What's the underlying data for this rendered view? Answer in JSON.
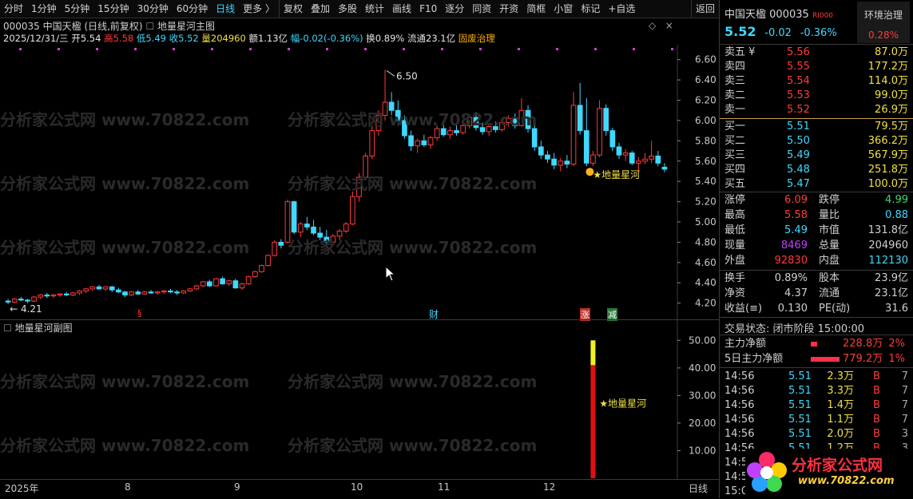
{
  "toolbar": {
    "items": [
      "分时",
      "1分钟",
      "5分钟",
      "15分钟",
      "30分钟",
      "60分钟",
      "日线",
      "更多 〉",
      "复权",
      "叠加",
      "多股",
      "统计",
      "画线",
      "F10",
      "逐分",
      "同资",
      "开资",
      "简框",
      "小窗",
      "标记",
      "+自选",
      "返回"
    ],
    "active": "日线"
  },
  "chart": {
    "code_name": "000035 中国天楹 (日线,前复权)",
    "indicator_name": "地量星河主图",
    "date": "2025/12/31/三",
    "open": "开5.54",
    "high": "高5.58",
    "low": "低5.49",
    "close": "收5.52",
    "volume": "量204960",
    "amount": "额1.13亿",
    "change": "幅-0.02(-0.36%)",
    "turnover": "换0.89%",
    "float": "流通23.1亿",
    "concept": "固废治理",
    "price_ticks": [
      "6.60",
      "6.40",
      "6.20",
      "6.00",
      "5.80",
      "5.60",
      "5.40",
      "5.20",
      "5.00",
      "4.80",
      "4.60",
      "4.40",
      "4.20"
    ],
    "max_label": "6.50",
    "min_label": "4.21",
    "signal_label": "★地量星河",
    "markers": {
      "s": "§",
      "cai": "财",
      "zhang": "涨",
      "jian": "减"
    }
  },
  "sub": {
    "name": "地量星河副图",
    "ticks": [
      "50.00",
      "40.00",
      "30.00",
      "20.00",
      "10.00"
    ],
    "signal_label": "★地量星河",
    "bar_value": 50,
    "bar_yellow_value": 41
  },
  "x_axis": {
    "labels": [
      "2025年",
      "8",
      "9",
      "10",
      "11",
      "12"
    ],
    "period": "日线"
  },
  "quote": {
    "name": "中国天楹",
    "code": "000035",
    "tag": "RI000",
    "sector": "环境治理",
    "sector_change": "0.28%",
    "price": "5.52",
    "change": "-0.02",
    "pct": "-0.36%",
    "sell": [
      {
        "l": "卖五 ¥",
        "p": "5.56",
        "v": "87.0万"
      },
      {
        "l": "卖四",
        "p": "5.55",
        "v": "177.2万"
      },
      {
        "l": "卖三",
        "p": "5.54",
        "v": "114.0万"
      },
      {
        "l": "卖二",
        "p": "5.53",
        "v": "99.0万"
      },
      {
        "l": "卖一",
        "p": "5.52",
        "v": "26.9万"
      }
    ],
    "buy": [
      {
        "l": "买一",
        "p": "5.51",
        "v": "79.5万"
      },
      {
        "l": "买二",
        "p": "5.50",
        "v": "366.2万"
      },
      {
        "l": "买三",
        "p": "5.49",
        "v": "567.9万"
      },
      {
        "l": "买四",
        "p": "5.48",
        "v": "251.8万"
      },
      {
        "l": "买五",
        "p": "5.47",
        "v": "100.0万"
      }
    ],
    "stats": [
      {
        "l1": "涨停",
        "v1": "6.09",
        "l2": "跌停",
        "v2": "4.99"
      },
      {
        "l1": "最高",
        "v1": "5.58",
        "l2": "量比",
        "v2": "0.88"
      },
      {
        "l1": "最低",
        "v1": "5.49",
        "l2": "市值",
        "v2": "131.8亿"
      },
      {
        "l1": "现量",
        "v1": "8469",
        "l2": "总量",
        "v2": "204960"
      },
      {
        "l1": "外盘",
        "v1": "92830",
        "l2": "内盘",
        "v2": "112130"
      }
    ],
    "stats2": [
      {
        "l1": "换手",
        "v1": "0.89%",
        "l2": "股本",
        "v2": "23.9亿"
      },
      {
        "l1": "净资",
        "v1": "4.37",
        "l2": "流通",
        "v2": "23.1亿"
      },
      {
        "l1": "收益(≡)",
        "v1": "0.130",
        "l2": "PE(动)",
        "v2": "31.6"
      }
    ],
    "status": "交易状态: 闭市阶段 15:00:00",
    "flow": [
      {
        "l": "主力净额",
        "v": "228.8万",
        "p": "2%"
      },
      {
        "l": "5日主力净额",
        "v": "779.2万",
        "p": "1%"
      }
    ],
    "ticks": [
      {
        "t": "14:56",
        "p": "5.51",
        "v": "2.3万",
        "s": "B",
        "n": "7"
      },
      {
        "t": "14:56",
        "p": "5.51",
        "v": "3.3万",
        "s": "B",
        "n": "7"
      },
      {
        "t": "14:56",
        "p": "5.51",
        "v": "1.4万",
        "s": "B",
        "n": "7"
      },
      {
        "t": "14:56",
        "p": "5.51",
        "v": "1.1万",
        "s": "B",
        "n": "7"
      },
      {
        "t": "14:56",
        "p": "5.51",
        "v": "2.0万",
        "s": "B",
        "n": "3"
      },
      {
        "t": "14:56",
        "p": "5.51",
        "v": "1.2万",
        "s": "B",
        "n": "3"
      },
      {
        "t": "14:5",
        "p": "",
        "v": "",
        "s": "",
        "n": ""
      },
      {
        "t": "14:5",
        "p": "",
        "v": "",
        "s": "",
        "n": ""
      },
      {
        "t": "15:0",
        "p": "",
        "v": "",
        "s": "",
        "n": ""
      }
    ],
    "logo": "分析家公式网",
    "logo_url": "www.70822.com"
  },
  "watermark": "分析家公式网 www.70822.com",
  "chart_data": {
    "type": "candlestick",
    "series": [
      {
        "name": "K线",
        "ohlc": [
          [
            4.22,
            4.24,
            4.19,
            4.21
          ],
          [
            4.21,
            4.25,
            4.2,
            4.24
          ],
          [
            4.24,
            4.26,
            4.22,
            4.23
          ],
          [
            4.23,
            4.24,
            4.2,
            4.22
          ],
          [
            4.22,
            4.27,
            4.21,
            4.26
          ],
          [
            4.26,
            4.29,
            4.24,
            4.28
          ],
          [
            4.28,
            4.3,
            4.25,
            4.27
          ],
          [
            4.27,
            4.29,
            4.25,
            4.28
          ],
          [
            4.28,
            4.3,
            4.26,
            4.29
          ],
          [
            4.29,
            4.31,
            4.27,
            4.28
          ],
          [
            4.28,
            4.31,
            4.27,
            4.3
          ],
          [
            4.3,
            4.33,
            4.28,
            4.32
          ],
          [
            4.32,
            4.35,
            4.3,
            4.34
          ],
          [
            4.34,
            4.37,
            4.32,
            4.36
          ],
          [
            4.36,
            4.38,
            4.33,
            4.34
          ],
          [
            4.34,
            4.37,
            4.32,
            4.36
          ],
          [
            4.36,
            4.37,
            4.31,
            4.33
          ],
          [
            4.33,
            4.35,
            4.3,
            4.31
          ],
          [
            4.31,
            4.32,
            4.26,
            4.28
          ],
          [
            4.28,
            4.32,
            4.27,
            4.31
          ],
          [
            4.31,
            4.33,
            4.28,
            4.29
          ],
          [
            4.29,
            4.32,
            4.28,
            4.31
          ],
          [
            4.31,
            4.33,
            4.29,
            4.3
          ],
          [
            4.3,
            4.32,
            4.28,
            4.31
          ],
          [
            4.31,
            4.33,
            4.29,
            4.32
          ],
          [
            4.32,
            4.34,
            4.3,
            4.31
          ],
          [
            4.31,
            4.33,
            4.28,
            4.3
          ],
          [
            4.3,
            4.33,
            4.29,
            4.32
          ],
          [
            4.32,
            4.35,
            4.31,
            4.34
          ],
          [
            4.34,
            4.38,
            4.33,
            4.37
          ],
          [
            4.37,
            4.42,
            4.36,
            4.41
          ],
          [
            4.41,
            4.43,
            4.36,
            4.37
          ],
          [
            4.37,
            4.45,
            4.36,
            4.44
          ],
          [
            4.44,
            4.46,
            4.38,
            4.39
          ],
          [
            4.39,
            4.43,
            4.37,
            4.42
          ],
          [
            4.42,
            4.44,
            4.34,
            4.35
          ],
          [
            4.35,
            4.4,
            4.33,
            4.39
          ],
          [
            4.39,
            4.47,
            4.38,
            4.46
          ],
          [
            4.46,
            4.52,
            4.45,
            4.51
          ],
          [
            4.51,
            4.58,
            4.5,
            4.57
          ],
          [
            4.57,
            4.68,
            4.56,
            4.67
          ],
          [
            4.67,
            4.82,
            4.66,
            4.8
          ],
          [
            4.8,
            4.83,
            4.74,
            4.77
          ],
          [
            4.8,
            5.22,
            4.79,
            5.2
          ],
          [
            5.2,
            5.21,
            4.88,
            4.9
          ],
          [
            4.9,
            5.0,
            4.85,
            4.98
          ],
          [
            4.98,
            5.05,
            4.92,
            4.95
          ],
          [
            4.95,
            5.02,
            4.87,
            4.89
          ],
          [
            4.89,
            4.95,
            4.82,
            4.85
          ],
          [
            4.85,
            4.92,
            4.78,
            4.8
          ],
          [
            4.8,
            4.88,
            4.77,
            4.86
          ],
          [
            4.86,
            4.93,
            4.82,
            4.91
          ],
          [
            4.91,
            5.0,
            4.89,
            4.98
          ],
          [
            4.98,
            5.3,
            4.97,
            5.25
          ],
          [
            5.25,
            5.48,
            5.2,
            5.44
          ],
          [
            5.44,
            5.68,
            5.42,
            5.65
          ],
          [
            5.65,
            5.95,
            5.62,
            5.9
          ],
          [
            5.9,
            6.1,
            5.85,
            6.05
          ],
          [
            6.05,
            6.5,
            6.0,
            6.18
          ],
          [
            6.18,
            6.28,
            6.05,
            6.1
          ],
          [
            6.1,
            6.2,
            5.95,
            6.0
          ],
          [
            6.0,
            6.05,
            5.82,
            5.85
          ],
          [
            5.85,
            5.9,
            5.7,
            5.75
          ],
          [
            5.75,
            5.82,
            5.68,
            5.8
          ],
          [
            5.8,
            5.86,
            5.74,
            5.76
          ],
          [
            5.76,
            5.85,
            5.72,
            5.83
          ],
          [
            5.83,
            5.95,
            5.8,
            5.92
          ],
          [
            5.92,
            5.98,
            5.84,
            5.86
          ],
          [
            5.86,
            5.94,
            5.82,
            5.9
          ],
          [
            5.9,
            5.96,
            5.85,
            5.88
          ],
          [
            5.88,
            5.98,
            5.86,
            5.95
          ],
          [
            5.95,
            6.06,
            5.92,
            6.03
          ],
          [
            6.03,
            6.08,
            5.9,
            5.93
          ],
          [
            5.93,
            5.98,
            5.86,
            5.89
          ],
          [
            5.89,
            5.96,
            5.85,
            5.94
          ],
          [
            5.94,
            5.99,
            5.88,
            5.91
          ],
          [
            5.91,
            6.0,
            5.89,
            5.98
          ],
          [
            5.98,
            6.05,
            5.94,
            6.02
          ],
          [
            6.02,
            6.07,
            5.92,
            5.95
          ],
          [
            5.95,
            6.22,
            5.94,
            6.1
          ],
          [
            6.1,
            6.15,
            5.88,
            5.92
          ],
          [
            5.92,
            5.96,
            5.7,
            5.74
          ],
          [
            5.74,
            5.8,
            5.62,
            5.66
          ],
          [
            5.66,
            5.7,
            5.58,
            5.62
          ],
          [
            5.62,
            5.68,
            5.52,
            5.56
          ],
          [
            5.56,
            5.63,
            5.5,
            5.6
          ],
          [
            5.6,
            5.66,
            5.53,
            5.57
          ],
          [
            5.57,
            6.28,
            5.55,
            6.15
          ],
          [
            6.15,
            6.37,
            5.86,
            5.9
          ],
          [
            5.9,
            6.22,
            5.55,
            5.58
          ],
          [
            5.58,
            5.7,
            5.55,
            5.66
          ],
          [
            5.66,
            6.2,
            5.64,
            6.12
          ],
          [
            6.12,
            6.16,
            5.85,
            5.9
          ],
          [
            5.9,
            5.93,
            5.7,
            5.74
          ],
          [
            5.74,
            5.78,
            5.62,
            5.66
          ],
          [
            5.66,
            5.72,
            5.6,
            5.68
          ],
          [
            5.68,
            5.7,
            5.56,
            5.58
          ],
          [
            5.58,
            5.64,
            5.5,
            5.6
          ],
          [
            5.6,
            5.68,
            5.57,
            5.62
          ],
          [
            5.62,
            5.8,
            5.58,
            5.65
          ],
          [
            5.65,
            5.7,
            5.55,
            5.58
          ],
          [
            5.54,
            5.58,
            5.49,
            5.52
          ]
        ]
      }
    ],
    "ylim": [
      4.15,
      6.7
    ],
    "sub_series": [
      {
        "name": "地量星河",
        "index": 90,
        "value": 50,
        "yellow_from": 41
      }
    ],
    "sub_ylim": [
      0,
      55
    ]
  }
}
